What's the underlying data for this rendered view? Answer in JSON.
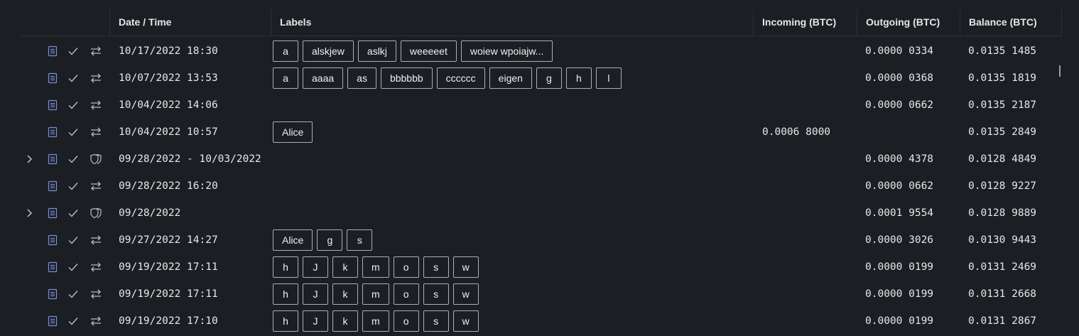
{
  "columns": {
    "date": "Date / Time",
    "labels": "Labels",
    "incoming": "Incoming (BTC)",
    "outgoing": "Outgoing (BTC)",
    "balance": "Balance (BTC)"
  },
  "rows": [
    {
      "expandable": false,
      "type": "transfer",
      "date": "10/17/2022 18:30",
      "labels": [
        "a",
        "alskjew",
        "aslkj",
        "weeeeet",
        "woiew wpoiajw..."
      ],
      "incoming": "",
      "outgoing": "0.0000 0334",
      "balance": "0.0135 1485"
    },
    {
      "expandable": false,
      "type": "transfer",
      "date": "10/07/2022 13:53",
      "labels": [
        "a",
        "aaaa",
        "as",
        "bbbbbb",
        "cccccc",
        "eigen",
        "g",
        "h",
        "l"
      ],
      "incoming": "",
      "outgoing": "0.0000 0368",
      "balance": "0.0135 1819"
    },
    {
      "expandable": false,
      "type": "transfer",
      "date": "10/04/2022 14:06",
      "labels": [],
      "incoming": "",
      "outgoing": "0.0000 0662",
      "balance": "0.0135 2187"
    },
    {
      "expandable": false,
      "type": "transfer",
      "date": "10/04/2022 10:57",
      "labels": [
        "Alice"
      ],
      "incoming": "0.0006 8000",
      "outgoing": "",
      "balance": "0.0135 2849"
    },
    {
      "expandable": true,
      "type": "group",
      "date": "09/28/2022 - 10/03/2022",
      "labels": [],
      "incoming": "",
      "outgoing": "0.0000 4378",
      "balance": "0.0128 4849"
    },
    {
      "expandable": false,
      "type": "transfer",
      "date": "09/28/2022 16:20",
      "labels": [],
      "incoming": "",
      "outgoing": "0.0000 0662",
      "balance": "0.0128 9227"
    },
    {
      "expandable": true,
      "type": "group",
      "date": "09/28/2022",
      "labels": [],
      "incoming": "",
      "outgoing": "0.0001 9554",
      "balance": "0.0128 9889"
    },
    {
      "expandable": false,
      "type": "transfer",
      "date": "09/27/2022 14:27",
      "labels": [
        "Alice",
        "g",
        "s"
      ],
      "incoming": "",
      "outgoing": "0.0000 3026",
      "balance": "0.0130 9443"
    },
    {
      "expandable": false,
      "type": "transfer",
      "date": "09/19/2022 17:11",
      "labels": [
        "h",
        "J",
        "k",
        "m",
        "o",
        "s",
        "w"
      ],
      "incoming": "",
      "outgoing": "0.0000 0199",
      "balance": "0.0131 2469"
    },
    {
      "expandable": false,
      "type": "transfer",
      "date": "09/19/2022 17:11",
      "labels": [
        "h",
        "J",
        "k",
        "m",
        "o",
        "s",
        "w"
      ],
      "incoming": "",
      "outgoing": "0.0000 0199",
      "balance": "0.0131 2668"
    },
    {
      "expandable": false,
      "type": "transfer",
      "date": "09/19/2022 17:10",
      "labels": [
        "h",
        "J",
        "k",
        "m",
        "o",
        "s",
        "w"
      ],
      "incoming": "",
      "outgoing": "0.0000 0199",
      "balance": "0.0131 2867"
    }
  ],
  "icons": {
    "expand": "chevron-right-icon",
    "document": "document-icon",
    "status": "check-icon",
    "transfer": "transfer-arrows-icon",
    "group": "shield-group-icon"
  },
  "colors": {
    "background": "#1b1e23",
    "accent_icon": "#7a8fd6",
    "muted_icon": "#b8bcc4"
  }
}
